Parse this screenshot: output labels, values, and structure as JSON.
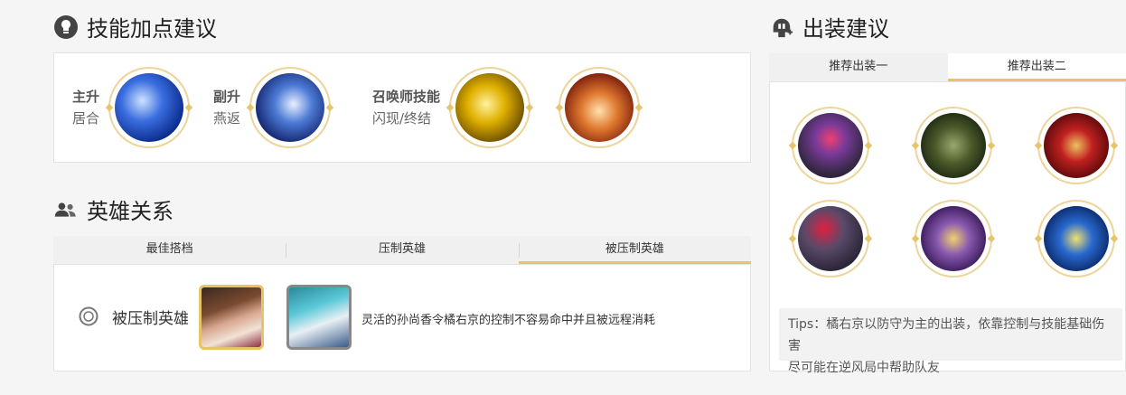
{
  "skill_section": {
    "title": "技能加点建议"
  },
  "skills": {
    "main": {
      "label": "主升",
      "name": "居合"
    },
    "secondary": {
      "label": "副升",
      "name": "燕返"
    },
    "summoner": {
      "label": "召唤师技能",
      "name": "闪现/终结"
    }
  },
  "hero_section": {
    "title": "英雄关系"
  },
  "hero_tabs": [
    "最佳搭档",
    "压制英雄",
    "被压制英雄"
  ],
  "hero_relation": {
    "label": "被压制英雄",
    "description": "灵活的孙尚香令橘右京的控制不容易命中并且被远程消耗"
  },
  "equip_section": {
    "title": "出装建议"
  },
  "equip_tabs": [
    "推荐出装一",
    "推荐出装二"
  ],
  "equip_items": [
    "item-1",
    "item-2",
    "item-3",
    "item-4",
    "item-5",
    "item-6"
  ],
  "tips": {
    "line1": "Tips：橘右京以防守为主的出装，依靠控制与技能基础伤害",
    "line2": "尽可能在逆风局中帮助队友"
  },
  "colors": {
    "accent": "#e8c36a",
    "ring": "#ecd49a"
  }
}
